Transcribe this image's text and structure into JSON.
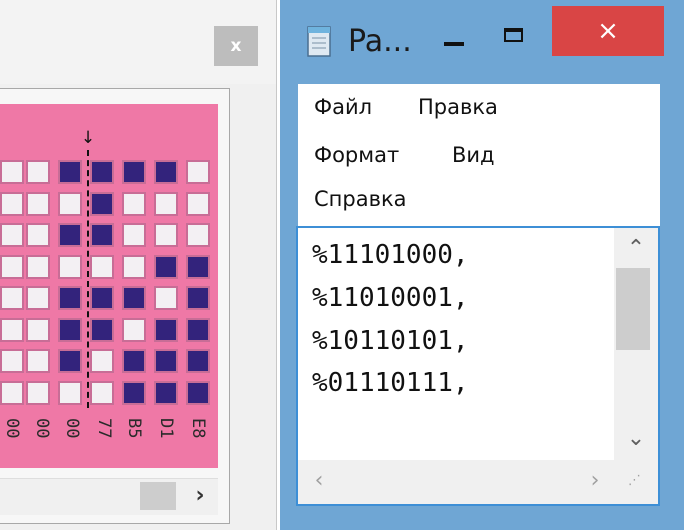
{
  "left_window": {
    "close_label": "x",
    "bit_rows": [
      "00011110",
      "00001000",
      "00011000",
      "00000011",
      "00011101",
      "00011011",
      "00010111",
      "00000111"
    ],
    "hex_columns": [
      "00",
      "00",
      "00",
      "77",
      "B5",
      "D1",
      "E8"
    ],
    "colors": {
      "panel": "#ef78a6",
      "bit_on": "#33237c",
      "bit_off": "#f3f0f3",
      "cell_border": "#c86d96"
    }
  },
  "notepad": {
    "title": "Pa...",
    "close_label": "×",
    "menu": [
      "Файл",
      "Правка",
      "Формат",
      "Вид",
      "Справка"
    ],
    "lines": [
      "%11101000,",
      "%11010001,",
      "%10110101,",
      "%01110111,"
    ],
    "colors": {
      "frame": "#6fa6d4",
      "close_button": "#d94545",
      "edit_border": "#3d8fd6"
    }
  }
}
